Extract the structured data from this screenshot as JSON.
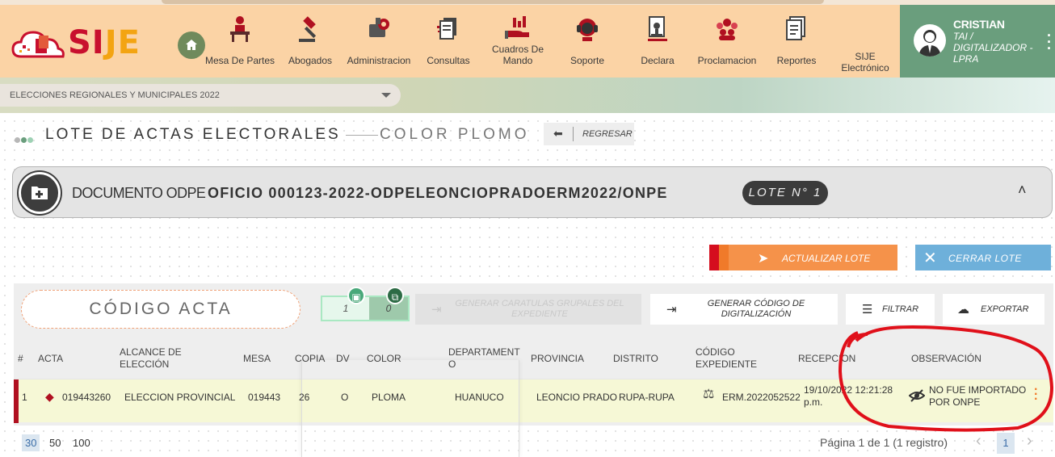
{
  "brand": {
    "name_a": "SI",
    "name_b": "JE"
  },
  "nav": [
    {
      "label": "",
      "icon": "home-icon"
    },
    {
      "label": "Mesa De Partes",
      "icon": "desk-icon"
    },
    {
      "label": "Abogados",
      "icon": "gavel-icon"
    },
    {
      "label": "Administracion",
      "icon": "admin-icon"
    },
    {
      "label": "Consultas",
      "icon": "documents-icon"
    },
    {
      "label": "Cuadros De Mando",
      "icon": "hand-chart-icon"
    },
    {
      "label": "Soporte",
      "icon": "headset-icon"
    },
    {
      "label": "Declara",
      "icon": "stamp-icon"
    },
    {
      "label": "Proclamacion",
      "icon": "people-icon"
    },
    {
      "label": "Reportes",
      "icon": "report-icon"
    },
    {
      "label": "SIJE Electrónico",
      "icon": ""
    }
  ],
  "user": {
    "name": "CRISTIAN",
    "role": "TAI / DIGITALIZADOR - LPRA"
  },
  "election_select": {
    "value": "ELECCIONES REGIONALES Y MUNICIPALES 2022"
  },
  "page": {
    "title": "LOTE DE ACTAS ELECTORALES",
    "subtitle": "COLOR PLOMO",
    "back_label": "REGRESAR"
  },
  "document": {
    "label": "DOCUMENTO ODPE",
    "number": "OFICIO 000123-2022-ODPELEONCIOPRADOERM2022/ONPE",
    "lote": "LOTE N° 1"
  },
  "actions": {
    "update": "ACTUALIZAR LOTE",
    "close": "CERRAR LOTE"
  },
  "toolbar": {
    "codigo_placeholder": "CÓDIGO ACTA",
    "count_a": "1",
    "count_b": "0",
    "caratulas": "GENERAR CARATULAS GRUPALES DEL EXPEDIENTE",
    "generar_codigo": "GENERAR CÓDIGO DE DIGITALIZACIÓN",
    "filtrar": "FILTRAR",
    "exportar": "EXPORTAR"
  },
  "table": {
    "headers": {
      "num": "#",
      "acta": "ACTA",
      "alcance": "ALCANCE DE ELECCIÓN",
      "mesa": "MESA",
      "copia": "COPIA",
      "dv": "DV",
      "color": "COLOR",
      "departamento": "DEPARTAMENT O",
      "provincia": "PROVINCIA",
      "distrito": "DISTRITO",
      "codigo": "CÓDIGO EXPEDIENTE",
      "recepcion": "RECEPCION",
      "observacion": "OBSERVACIÓN"
    },
    "row": {
      "num": "1",
      "acta": "019443260",
      "alcance": "ELECCION PROVINCIAL",
      "mesa": "019443",
      "copia": "26",
      "dv": "O",
      "color": "PLOMA",
      "departamento": "HUANUCO",
      "provincia": "LEONCIO PRADO",
      "distrito": "RUPA-RUPA",
      "codigo": "ERM.2022052522",
      "recepcion": "19/10/2022 12:21:28 p.m.",
      "observacion": "NO FUE IMPORTADO POR ONPE"
    }
  },
  "pagination": {
    "sizes": [
      "30",
      "50",
      "100"
    ],
    "info": "Página 1 de 1 (1 registro)",
    "current": "1"
  },
  "colors": {
    "header": "#fbd3a5",
    "user_panel": "#6a9e7d",
    "accent_red": "#c8102e",
    "accent_orange": "#f5924a"
  }
}
